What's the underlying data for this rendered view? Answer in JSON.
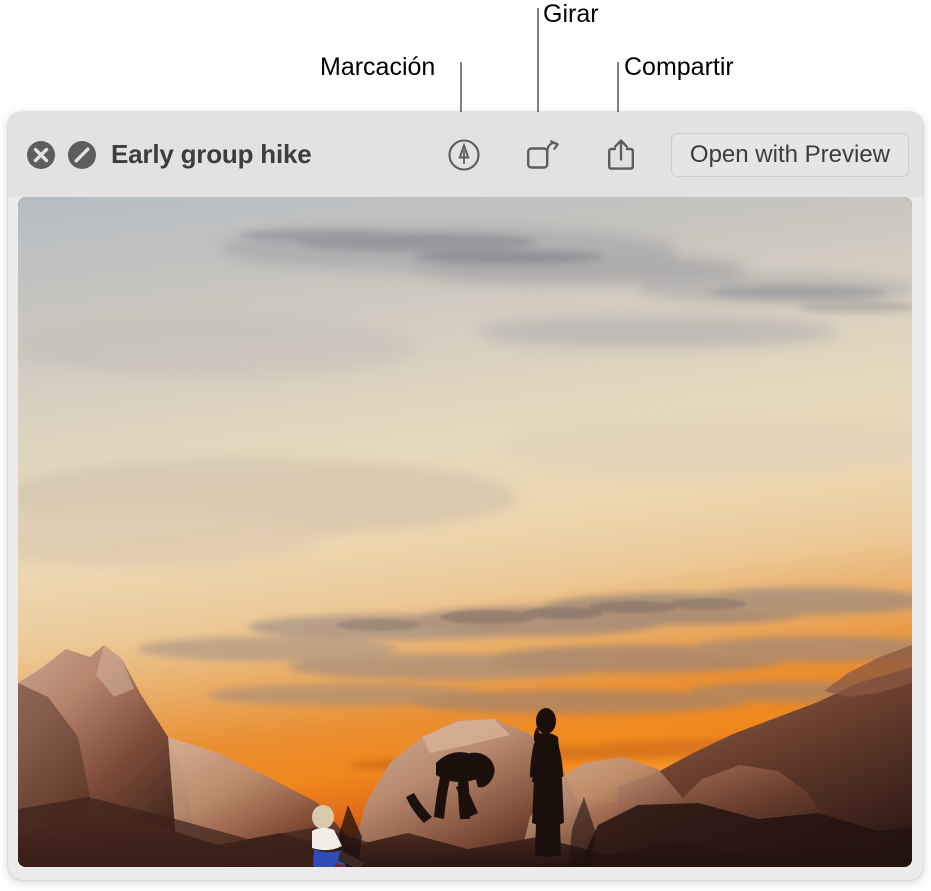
{
  "annotations": [
    {
      "id": "marcacion",
      "label": "Marcación",
      "target": "markup-icon"
    },
    {
      "id": "girar",
      "label": "Girar",
      "target": "rotate-icon"
    },
    {
      "id": "compartir",
      "label": "Compartir",
      "target": "share-icon"
    }
  ],
  "window": {
    "toolbar": {
      "close_icon": "close-circle-icon",
      "fullscreen_icon": "quicklook-fullscreen-icon",
      "title": "Early group hike",
      "markup_icon": "markup-pen-icon",
      "rotate_icon": "rotate-left-icon",
      "share_icon": "share-arrow-up-icon",
      "open_button_label": "Open with Preview"
    },
    "content": {
      "type": "photograph",
      "description": "Three hikers silhouetted on red sandstone rocks at sunset"
    }
  },
  "colors": {
    "toolbar_bg": "#e3e1e1",
    "window_bg": "#eceaea",
    "title_text": "#3d3d3d",
    "icon_gray": "#5d5d5d",
    "leader_line": "#808080",
    "callout_text": "#000000",
    "sky_top": "#b9bec4",
    "sky_mid": "#e8d9bd",
    "sunset_orange": "#f08a1e",
    "sunset_deep": "#d9541a",
    "rock_light": "#c9a08a",
    "rock_dark": "#3a201a"
  }
}
